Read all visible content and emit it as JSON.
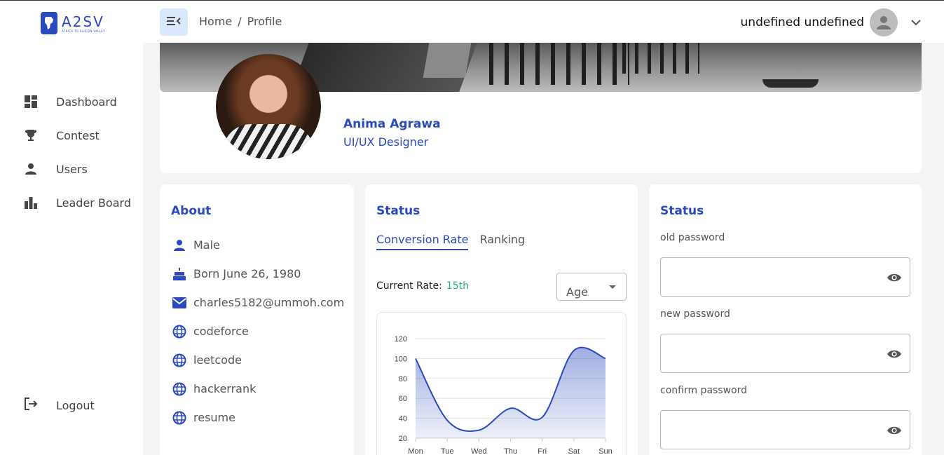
{
  "brand": {
    "logo_text": "A2SV",
    "logo_sub": "AFRICA TO SILICON VALLEY"
  },
  "sidebar": {
    "items": [
      {
        "label": "Dashboard",
        "icon": "dashboard-icon"
      },
      {
        "label": "Contest",
        "icon": "trophy-icon"
      },
      {
        "label": "Users",
        "icon": "user-icon"
      },
      {
        "label": "Leader Board",
        "icon": "bar-chart-icon"
      }
    ],
    "logout_label": "Logout"
  },
  "header": {
    "breadcrumb": [
      "Home",
      "/",
      "Profile"
    ],
    "user_name": "undefined undefined"
  },
  "profile": {
    "name": "Anima Agrawa",
    "role": "UI/UX Designer"
  },
  "about": {
    "title": "About",
    "items": [
      {
        "icon": "person-icon",
        "text": "Male"
      },
      {
        "icon": "cake-icon",
        "text": "Born June 26, 1980"
      },
      {
        "icon": "mail-icon",
        "text": "charles5182@ummoh.com"
      },
      {
        "icon": "globe-icon",
        "text": "codeforce"
      },
      {
        "icon": "globe-icon",
        "text": "leetcode"
      },
      {
        "icon": "globe-icon",
        "text": "hackerrank"
      },
      {
        "icon": "globe-icon",
        "text": "resume"
      }
    ]
  },
  "status": {
    "title": "Status",
    "tabs": [
      "Conversion Rate",
      "Ranking"
    ],
    "active_tab": 0,
    "current_rate_label": "Current Rate:",
    "current_rate_value": "15th",
    "select_value": "Age"
  },
  "chart_data": {
    "type": "area",
    "categories": [
      "Mon",
      "Tue",
      "Wed",
      "Thu",
      "Fri",
      "Sat",
      "Sun"
    ],
    "series": [
      {
        "values": [
          100,
          38,
          28,
          50,
          41,
          108,
          100
        ]
      }
    ],
    "yticks": [
      20,
      40,
      60,
      80,
      100,
      120
    ],
    "ylim": [
      20,
      120
    ],
    "grid": true,
    "color": "#2a4bbd"
  },
  "password": {
    "title": "Status",
    "old_label": "old password",
    "new_label": "new password",
    "confirm_label": "confirm password"
  },
  "colors": {
    "accent": "#2a4bbd",
    "rate": "#22b573"
  }
}
